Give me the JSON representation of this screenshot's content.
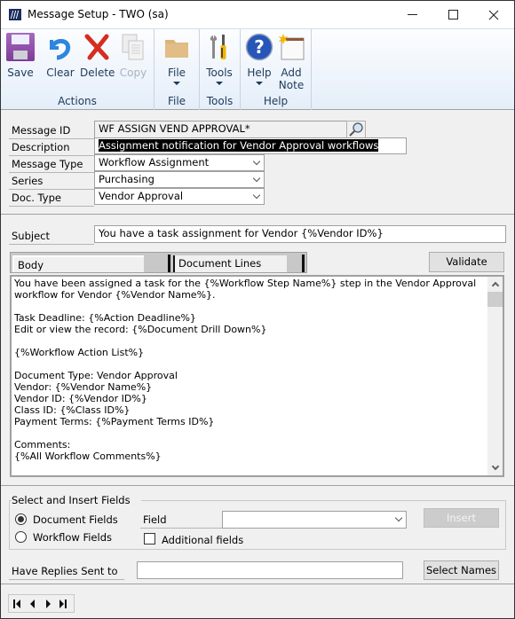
{
  "window": {
    "title": "Message Setup  -  TWO (sa)",
    "controls": {
      "minimize": "minimize",
      "maximize": "maximize",
      "close": "close"
    }
  },
  "ribbon": {
    "groups": [
      {
        "label": "Actions",
        "buttons": [
          {
            "label": "Save",
            "icon": "save-icon",
            "enabled": true
          },
          {
            "label": "Clear",
            "icon": "undo-arrow-icon",
            "enabled": true
          },
          {
            "label": "Delete",
            "icon": "red-x-icon",
            "enabled": true
          },
          {
            "label": "Copy",
            "icon": "copy-icon",
            "enabled": false
          }
        ]
      },
      {
        "label": "File",
        "buttons": [
          {
            "label": "File",
            "icon": "folder-icon",
            "dropdown": true
          }
        ]
      },
      {
        "label": "Tools",
        "buttons": [
          {
            "label": "Tools",
            "icon": "tools-icon",
            "dropdown": true
          }
        ]
      },
      {
        "label": "Help",
        "buttons": [
          {
            "label": "Help",
            "icon": "help-icon",
            "dropdown": true
          },
          {
            "label_line1": "Add",
            "label_line2": "Note",
            "icon": "add-note-icon"
          }
        ]
      }
    ]
  },
  "form": {
    "message_id": {
      "label": "Message ID",
      "value": "WF ASSIGN VEND APPROVAL*"
    },
    "description": {
      "label": "Description",
      "value": "Assignment notification for Vendor Approval workflows"
    },
    "message_type": {
      "label": "Message Type",
      "value": "Workflow Assignment"
    },
    "series": {
      "label": "Series",
      "value": "Purchasing"
    },
    "doc_type": {
      "label": "Doc. Type",
      "value": "Vendor Approval"
    },
    "subject": {
      "label": "Subject",
      "value": "You have a task assignment for Vendor  {%Vendor ID%}"
    }
  },
  "tabs": [
    {
      "label": "Body",
      "active": true
    },
    {
      "label": "Document Lines",
      "active": false
    }
  ],
  "validate_label": "Validate",
  "body_text": "You have been assigned a task for the {%Workflow Step Name%} step in the Vendor Approval workflow for Vendor {%Vendor Name%}.\n\nTask Deadline: {%Action Deadline%}\nEdit or view the record: {%Document Drill Down%}\n\n{%Workflow Action List%}\n\nDocument Type: Vendor Approval\nVendor: {%Vendor Name%}\nVendor ID: {%Vendor ID%}\nClass ID: {%Class ID%}\nPayment Terms: {%Payment Terms ID%}\n\nComments:\n{%All Workflow Comments%}",
  "insert_fields": {
    "title": "Select and Insert Fields",
    "options": [
      {
        "label": "Document Fields",
        "selected": true
      },
      {
        "label": "Workflow Fields",
        "selected": false
      }
    ],
    "field_label": "Field",
    "field_value": "",
    "additional_fields_label": "Additional fields",
    "additional_fields_checked": false,
    "insert_label": "Insert"
  },
  "replies": {
    "label": "Have Replies Sent to",
    "value": "",
    "select_names_label": "Select Names"
  },
  "navigation": [
    "first",
    "previous",
    "next",
    "last"
  ]
}
